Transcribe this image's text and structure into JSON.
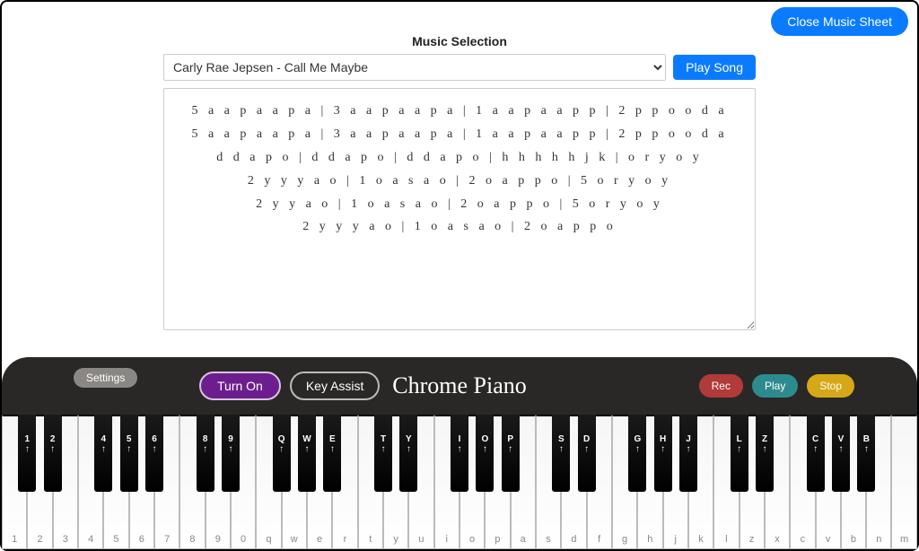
{
  "top": {
    "close": "Close Music Sheet"
  },
  "section": {
    "title": "Music Selection"
  },
  "song_select": {
    "selected": "Carly Rae Jepsen - Call Me Maybe"
  },
  "play_song": "Play Song",
  "sheet_lines": [
    "5 a a p a a p a | 3 a a p a a p a | 1 a a p a a p p | 2 p p o o d a",
    "5 a a p a a p a | 3 a a p a a p a | 1 a a p a a p p | 2 p p o o d a",
    "d d a p o | d d a p o | d d a p o | h h h h h j k | o r y o y",
    "2 y y y a o | 1 o a s a o | 2 o a p p o | 5 o r y o y",
    "2 y y a o | 1 o a s a o | 2 o a p p o | 5 o r y o y",
    "2 y y y a o | 1 o a s a o | 2 o a p p o"
  ],
  "toolbar": {
    "settings": "Settings",
    "turn_on": "Turn On",
    "key_assist": "Key Assist",
    "title": "Chrome Piano",
    "rec": "Rec",
    "play": "Play",
    "stop": "Stop"
  },
  "white_labels": [
    "1",
    "2",
    "3",
    "4",
    "5",
    "6",
    "7",
    "8",
    "9",
    "0",
    "q",
    "w",
    "e",
    "r",
    "t",
    "y",
    "u",
    "i",
    "o",
    "p",
    "a",
    "s",
    "d",
    "f",
    "g",
    "h",
    "j",
    "k",
    "l",
    "z",
    "x",
    "c",
    "v",
    "b",
    "n",
    "m"
  ],
  "black_keys": [
    {
      "after": 0,
      "label": "1"
    },
    {
      "after": 1,
      "label": "2"
    },
    {
      "after": 3,
      "label": "4"
    },
    {
      "after": 4,
      "label": "5"
    },
    {
      "after": 5,
      "label": "6"
    },
    {
      "after": 7,
      "label": "8"
    },
    {
      "after": 8,
      "label": "9"
    },
    {
      "after": 10,
      "label": "Q"
    },
    {
      "after": 11,
      "label": "W"
    },
    {
      "after": 12,
      "label": "E"
    },
    {
      "after": 14,
      "label": "T"
    },
    {
      "after": 15,
      "label": "Y"
    },
    {
      "after": 17,
      "label": "I"
    },
    {
      "after": 18,
      "label": "O"
    },
    {
      "after": 19,
      "label": "P"
    },
    {
      "after": 21,
      "label": "S"
    },
    {
      "after": 22,
      "label": "D"
    },
    {
      "after": 24,
      "label": "G"
    },
    {
      "after": 25,
      "label": "H"
    },
    {
      "after": 26,
      "label": "J"
    },
    {
      "after": 28,
      "label": "L"
    },
    {
      "after": 29,
      "label": "Z"
    },
    {
      "after": 31,
      "label": "C"
    },
    {
      "after": 32,
      "label": "V"
    },
    {
      "after": 33,
      "label": "B"
    }
  ]
}
